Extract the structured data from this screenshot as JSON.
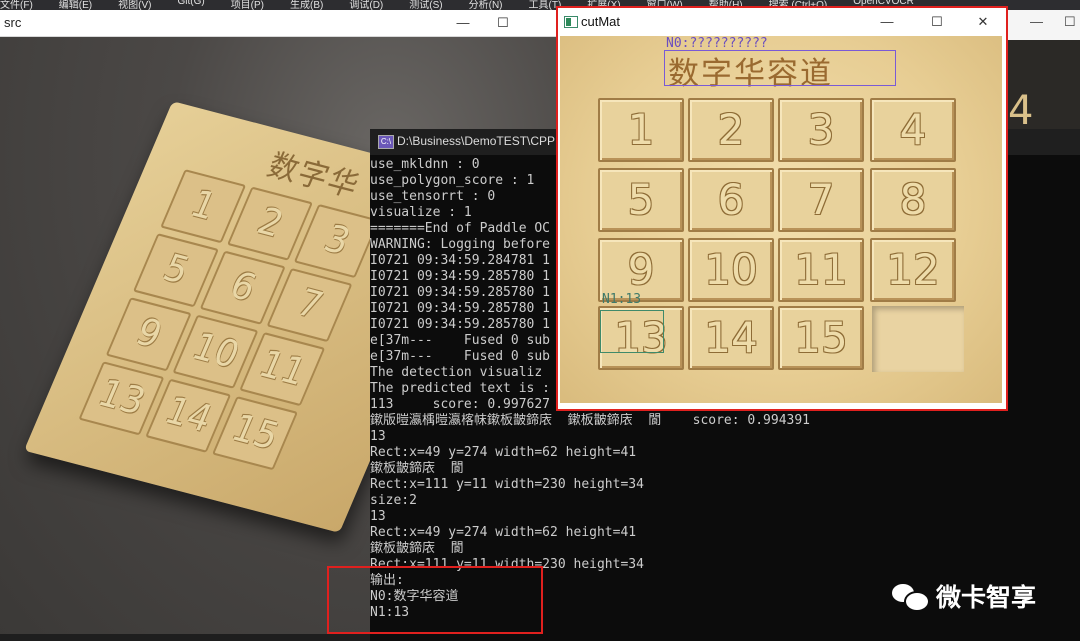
{
  "ide_menu": [
    "文件(F)",
    "编辑(E)",
    "视图(V)",
    "Git(G)",
    "项目(P)",
    "生成(B)",
    "调试(D)",
    "测试(S)",
    "分析(N)",
    "工具(T)",
    "扩展(X)",
    "窗口(W)",
    "帮助(H)",
    "搜索 (Ctrl+Q)",
    "OpenCVOCR"
  ],
  "src_window": {
    "title": "src",
    "buttons": [
      "—",
      "☐"
    ],
    "board_title": "数字华",
    "tiles": [
      "1",
      "2",
      "3",
      "5",
      "6",
      "7",
      "9",
      "10",
      "11",
      "13",
      "14",
      "15"
    ]
  },
  "console_window": {
    "title": "D:\\Business\\DemoTEST\\CPP",
    "icon_label": "C:\\",
    "lines": [
      "use_mkldnn : 0",
      "use_polygon_score : 1",
      "use_tensorrt : 0",
      "visualize : 1",
      "=======End of Paddle OC",
      "WARNING: Logging before",
      "I0721 09:34:59.284781 1",
      "I0721 09:34:59.285780 1",
      "I0721 09:34:59.285780 1",
      "I0721 09:34:59.285780 1",
      "I0721 09:34:59.285780 1",
      "e[37m---    Fused 0 sub",
      "e[37m---    Fused 0 sub",
      "The detection visualiz",
      "The predicted text is :",
      "113     score: 0.997627",
      "鏉版暟瀛楀暟瀛楁帓鏉板皵鍗庡  鏉板皵鍗庡  閬    score: 0.994391",
      "13",
      "Rect:x=49 y=274 width=62 height=41",
      "鏉板皵鍗庡  閬",
      "Rect:x=111 y=11 width=230 height=34",
      "size:2",
      "13",
      "Rect:x=49 y=274 width=62 height=41",
      "鏉板皵鍗庡  閬",
      "Rect:x=111 y=11 width=230 height=34",
      "输出:",
      "N0:数字华容道",
      "N1:13"
    ]
  },
  "cutmat_window": {
    "title": "cutMat",
    "buttons": [
      "—",
      "☐",
      "✕"
    ],
    "n0_label": "N0:??????????",
    "title_text": "数字华容道",
    "n1_label": "N1:13",
    "tiles": [
      "1",
      "2",
      "3",
      "4",
      "5",
      "6",
      "7",
      "8",
      "9",
      "10",
      "11",
      "12",
      "13",
      "14",
      "15"
    ]
  },
  "right_strip": {
    "buttons": [
      "—",
      "☐"
    ],
    "tile_partial": "4"
  },
  "watermark": {
    "text": "微卡智享"
  },
  "colors": {
    "highlight_red": "#e0201e",
    "console_bg": "#0c0c0c",
    "label_purple": "#6a4ec0",
    "label_green": "#3f7a6a"
  }
}
